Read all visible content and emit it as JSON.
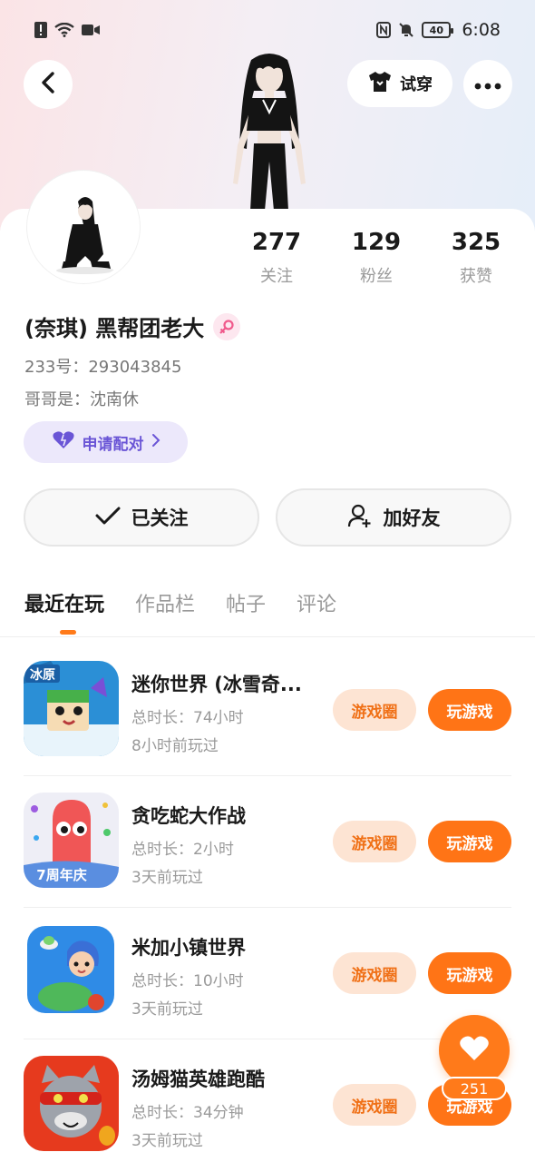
{
  "status_bar": {
    "time": "6:08",
    "battery": "40"
  },
  "header": {
    "tryon_label": "试穿"
  },
  "profile": {
    "name": "(奈琪) 黑帮团老大",
    "id_line": "233号：293043845",
    "brother_line": "哥哥是：沈南休",
    "pair_label": "申请配对",
    "stats": [
      {
        "value": "277",
        "label": "关注"
      },
      {
        "value": "129",
        "label": "粉丝"
      },
      {
        "value": "325",
        "label": "获赞"
      }
    ]
  },
  "actions": {
    "follow_label": "已关注",
    "friend_label": "加好友"
  },
  "tabs": [
    "最近在玩",
    "作品栏",
    "帖子",
    "评论"
  ],
  "games": [
    {
      "title": "迷你世界 (冰雪奇...",
      "duration": "总时长：74小时",
      "last": "8小时前玩过",
      "circle": "游戏圈",
      "play": "玩游戏"
    },
    {
      "title": "贪吃蛇大作战",
      "duration": "总时长：2小时",
      "last": "3天前玩过",
      "circle": "游戏圈",
      "play": "玩游戏"
    },
    {
      "title": "米加小镇世界",
      "duration": "总时长：10小时",
      "last": "3天前玩过",
      "circle": "游戏圈",
      "play": "玩游戏"
    },
    {
      "title": "汤姆猫英雄跑酷",
      "duration": "总时长：34分钟",
      "last": "3天前玩过",
      "circle": "游戏圈",
      "play": "玩游戏"
    }
  ],
  "game_icon_text": {
    "minecraft_badge": "冰原",
    "snake_badge": "7周年庆"
  },
  "like_fab": {
    "count": "251"
  },
  "colors": {
    "accent": "#ff7416",
    "pair_purple": "#6a55d6"
  }
}
